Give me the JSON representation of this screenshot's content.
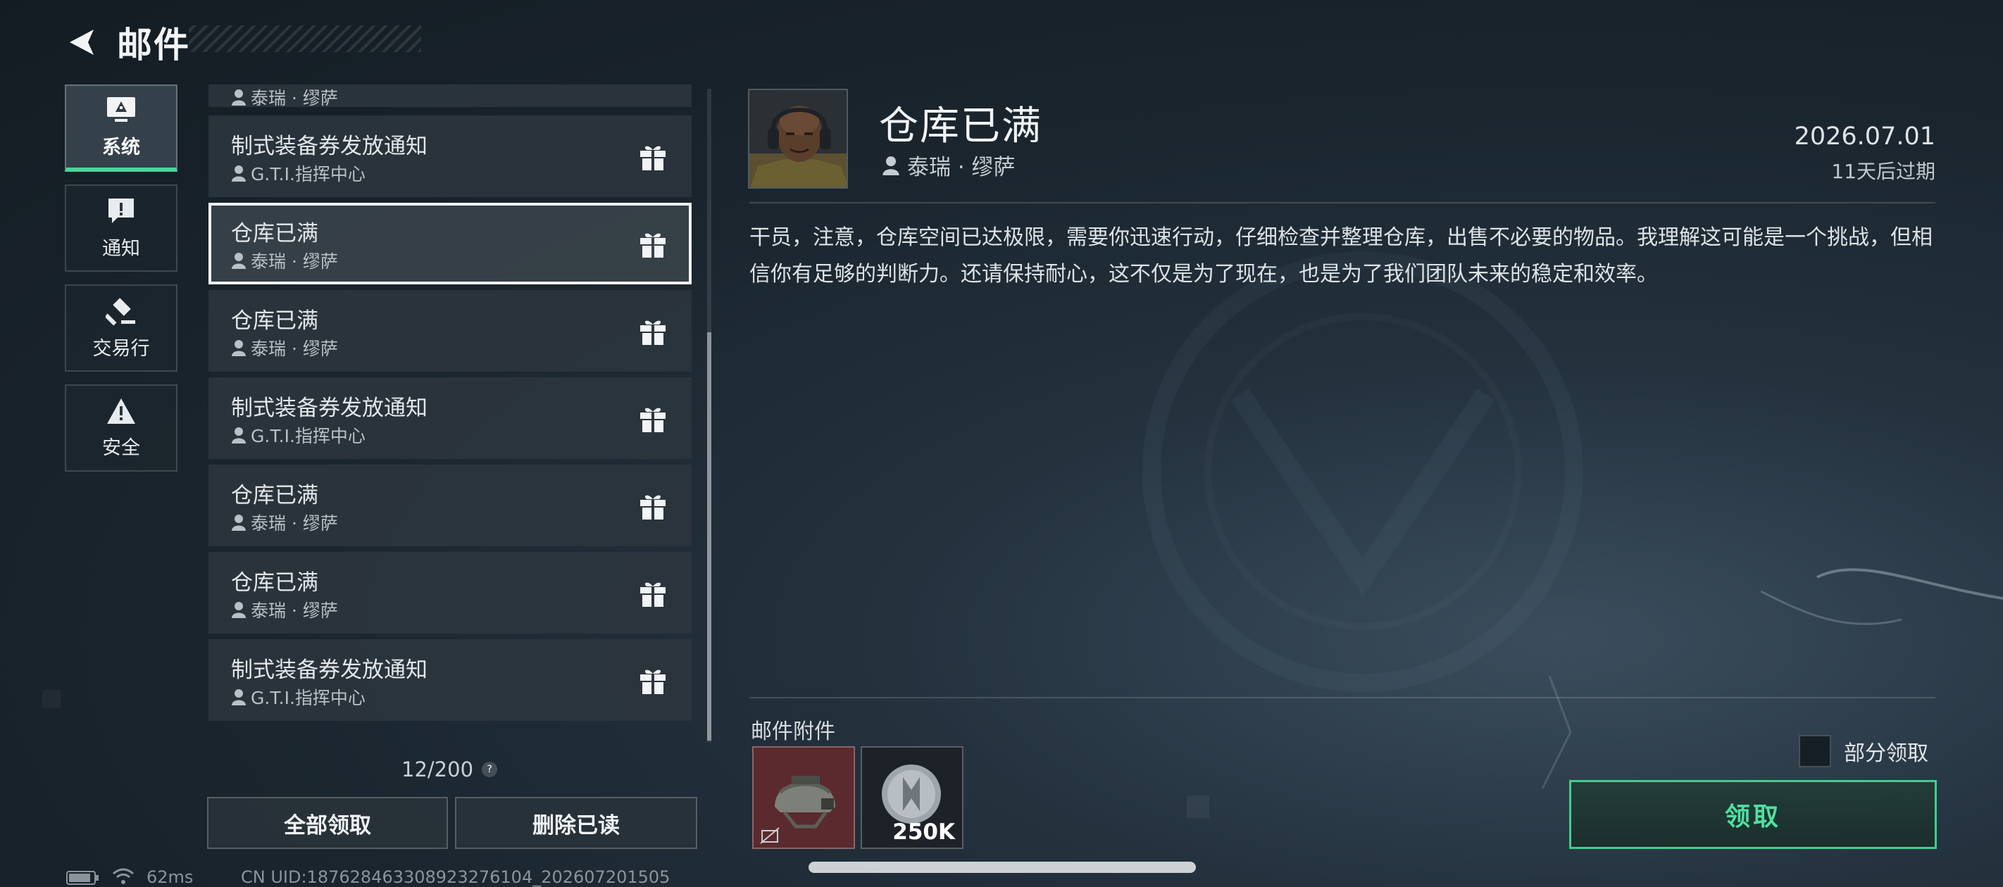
{
  "header": {
    "title": "邮件",
    "back_icon": "back-arrow-icon"
  },
  "nav": {
    "items": [
      {
        "label": "系统",
        "icon": "monitor-icon",
        "active": true
      },
      {
        "label": "通知",
        "icon": "notice-icon",
        "active": false
      },
      {
        "label": "交易行",
        "icon": "gavel-icon",
        "active": false
      },
      {
        "label": "安全",
        "icon": "warning-icon",
        "active": false
      }
    ]
  },
  "mail_list": {
    "partial_top": {
      "sender": "泰瑞 · 缪萨"
    },
    "items": [
      {
        "title": "制式装备券发放通知",
        "sender": "G.T.I.指挥中心",
        "selected": false
      },
      {
        "title": "仓库已满",
        "sender": "泰瑞 · 缪萨",
        "selected": true
      },
      {
        "title": "仓库已满",
        "sender": "泰瑞 · 缪萨",
        "selected": false
      },
      {
        "title": "制式装备券发放通知",
        "sender": "G.T.I.指挥中心",
        "selected": false
      },
      {
        "title": "仓库已满",
        "sender": "泰瑞 · 缪萨",
        "selected": false
      },
      {
        "title": "仓库已满",
        "sender": "泰瑞 · 缪萨",
        "selected": false
      },
      {
        "title": "制式装备券发放通知",
        "sender": "G.T.I.指挥中心",
        "selected": false
      }
    ],
    "count": "12/200",
    "help_symbol": "?",
    "claim_all_label": "全部领取",
    "delete_read_label": "删除已读"
  },
  "detail": {
    "title": "仓库已满",
    "sender": "泰瑞 · 缪萨",
    "date": "2026.07.01",
    "expire": "11天后过期",
    "body": "干员，注意，仓库空间已达极限，需要你迅速行动，仔细检查并整理仓库，出售不必要的物品。我理解这可能是一个挑战，但相信你有足够的判断力。还请保持耐心，这不仅是为了现在，也是为了我们团队未来的稳定和效率。",
    "attachments_label": "邮件附件",
    "attachments": [
      {
        "icon": "helmet-icon"
      },
      {
        "icon": "coin-icon",
        "quantity": "250K"
      }
    ],
    "partial_claim_label": "部分领取",
    "claim_label": "领取"
  },
  "footer": {
    "ping": "62ms",
    "uid": "CN UID:18762846330892327610​4_202607201505"
  },
  "colors": {
    "accent": "#4fd39a",
    "claim_text": "#4fe0a0"
  }
}
